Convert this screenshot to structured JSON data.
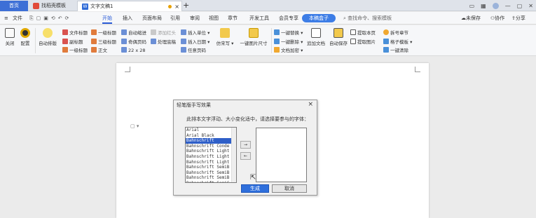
{
  "titlebar": {
    "home_tab": "首页",
    "templates_tab": "找稻壳模板",
    "doc_tab": "文字文稿1",
    "doc_tab_close": "×",
    "new_tab": "+"
  },
  "menubar": {
    "items": [
      "文件",
      "开始",
      "插入",
      "页面布局",
      "引用",
      "审阅",
      "视图",
      "章节",
      "开发工具",
      "会员专享"
    ],
    "active_pill": "本稿盒子",
    "search_placeholder": "查找命令、搜索模板",
    "right_items": [
      "未保存",
      "协作",
      "分享"
    ]
  },
  "ribbon": {
    "close": "关闭",
    "config": "配置",
    "auto_format": "自动排版",
    "heading_doc": "文件标题",
    "heading_1": "一级标题",
    "heading_2": "二级标题",
    "heading_3": "三级标题",
    "subtitle": "副标题",
    "normal": "正文",
    "auto_indent": "自动缩进",
    "odd_even_page": "奇偶页码",
    "page_size": "22 x 28",
    "add_red_head": "添加红头",
    "process_redhead": "处理底稿",
    "insert_unit": "插入单位",
    "insert_date": "插入日期",
    "arrange_page": "任意页码",
    "imitate_font": "仿宋写",
    "one_key_image_size": "一键图片尺寸",
    "one_key_replace": "一键替换",
    "one_key_delete": "一键删除",
    "text_add": "文档加密",
    "append_doc": "追加文档",
    "auto_save": "自动保存",
    "extract_page": "提取本页",
    "extract_image": "提取图片",
    "convert_book": "拆号章节",
    "grid_template": "格子模板",
    "one_key_clean": "一键清除"
  },
  "doc": {
    "paste_hint": "▢ ▾"
  },
  "dialog": {
    "title": "轻笔版手写效果",
    "close": "×",
    "prompt": "此排本文字浮动、大小变化适中，请选择要参与的字体：",
    "fonts": [
      "Arial",
      "Arial Black",
      "Bahnschrift",
      "Bahnschrift Conde",
      "Bahnschrift Light",
      "Bahnschrift Light",
      "Bahnschrift Light",
      "Bahnschrift SemiB",
      "Bahnschrift SemiB",
      "Bahnschrift SemiB",
      "Bahnschrift SemiC"
    ],
    "selected_index": 2,
    "add_arrow": "→",
    "remove_arrow": "←",
    "generate": "生成",
    "cancel": "取消"
  }
}
